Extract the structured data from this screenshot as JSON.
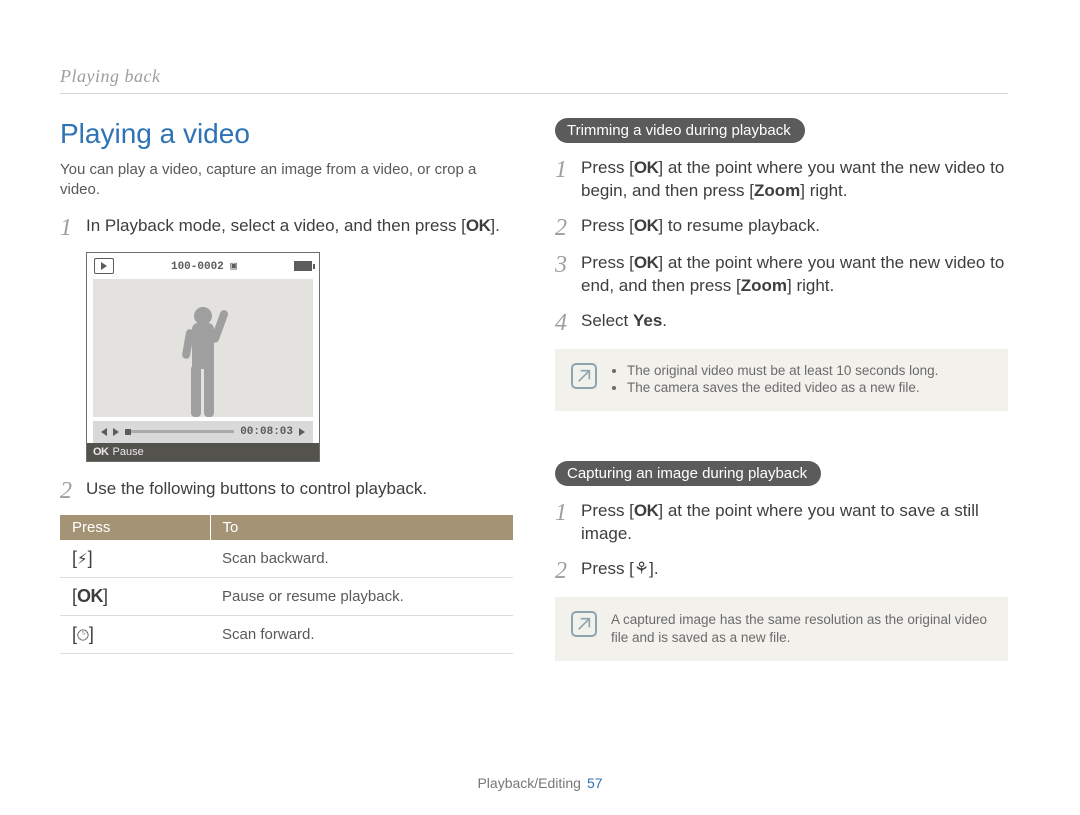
{
  "header": {
    "crumb": "Playing back"
  },
  "left": {
    "title": "Playing a video",
    "intro": "You can play a video, capture an image from a video, or crop a video.",
    "step1_pre": "In Playback mode, select a video, and then press [",
    "step1_ok": "OK",
    "step1_post": "].",
    "preview": {
      "file": "100-0002",
      "movie_icon": "▣",
      "time": "00:08:03",
      "footer_ok": "OK",
      "footer_label": "Pause"
    },
    "step2": "Use the following buttons to control playback.",
    "table": {
      "h1": "Press",
      "h2": "To",
      "rows": [
        {
          "key_open": "[",
          "key_sym": "flash",
          "key_close": "]",
          "desc": "Scan backward."
        },
        {
          "key_open": "[",
          "key_sym": "ok",
          "key_close": "]",
          "desc": "Pause or resume playback."
        },
        {
          "key_open": "[",
          "key_sym": "timer",
          "key_close": "]",
          "desc": "Scan forward."
        }
      ]
    }
  },
  "right": {
    "trim": {
      "heading": "Trimming a video during playback",
      "s1_a": "Press [",
      "s1_ok": "OK",
      "s1_b": "] at the point where you want the new video to begin, and then press [",
      "s1_zoom": "Zoom",
      "s1_c": "] right.",
      "s2_a": "Press [",
      "s2_ok": "OK",
      "s2_b": "] to resume playback.",
      "s3_a": "Press [",
      "s3_ok": "OK",
      "s3_b": "] at the point where you want the new video to end, and then press [",
      "s3_zoom": "Zoom",
      "s3_c": "] right.",
      "s4_a": "Select ",
      "s4_yes": "Yes",
      "s4_b": ".",
      "note": {
        "b1": "The original video must be at least 10 seconds long.",
        "b2": "The camera saves the edited video as a new file."
      }
    },
    "cap": {
      "heading": "Capturing an image during playback",
      "s1_a": "Press [",
      "s1_ok": "OK",
      "s1_b": "] at the point where you want to save a still image.",
      "s2_a": "Press [",
      "s2_b": "].",
      "note": "A captured image has the same resolution as the original video file and is saved as a new file."
    }
  },
  "footer": {
    "section": "Playback/Editing",
    "page": "57"
  }
}
